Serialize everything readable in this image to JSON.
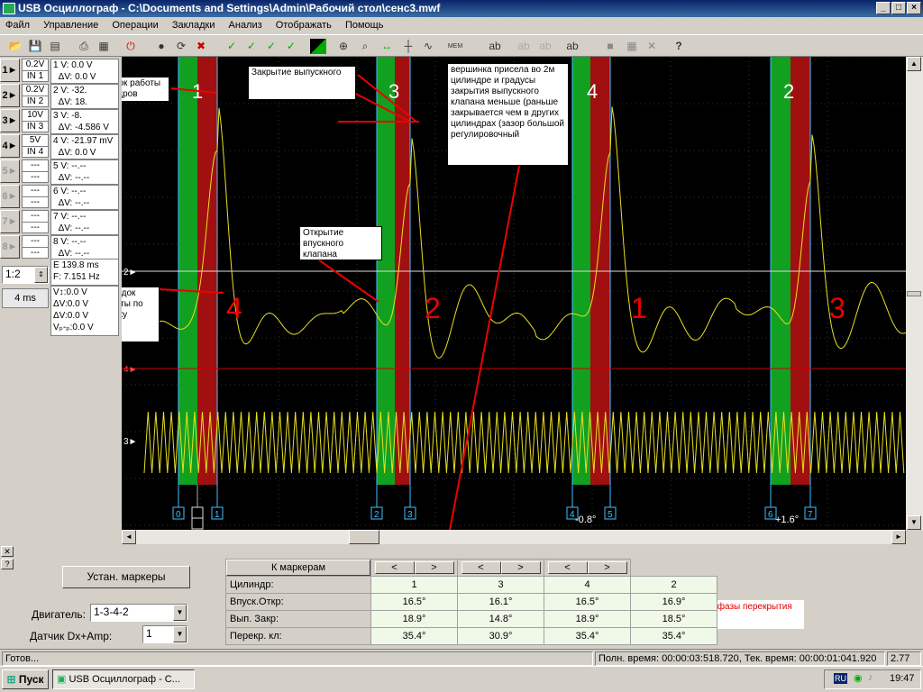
{
  "window": {
    "title": "USB Осциллограф - C:\\Documents and Settings\\Admin\\Рабочий стол\\сенс3.mwf"
  },
  "menu": [
    "Файл",
    "Управление",
    "Операции",
    "Закладки",
    "Анализ",
    "Отображать",
    "Помощь"
  ],
  "channels": [
    {
      "num": "1",
      "scale": "0.2V",
      "input": "IN 1",
      "v": "0.0 V",
      "dv": "0.0 V"
    },
    {
      "num": "2",
      "scale": "0.2V",
      "input": "IN 2",
      "v": "-32.",
      "dv": "18."
    },
    {
      "num": "3",
      "scale": "10V",
      "input": "IN 3",
      "v": "-8.",
      "dv": "-4.586 V"
    },
    {
      "num": "4",
      "scale": "5V",
      "input": "IN 4",
      "v": "-21.97 mV",
      "dv": "0.0 V"
    },
    {
      "num": "5",
      "scale": "---",
      "input": "---",
      "v": "--.--",
      "dv": "--.--"
    },
    {
      "num": "6",
      "scale": "---",
      "input": "---",
      "v": "--.--",
      "dv": "--.--"
    },
    {
      "num": "7",
      "scale": "---",
      "input": "---",
      "v": "--.--",
      "dv": "--.--"
    },
    {
      "num": "8",
      "scale": "---",
      "input": "---",
      "v": "--.--",
      "dv": "--.--"
    }
  ],
  "vlabels": {
    "v": "V:",
    "dv": "ΔV:"
  },
  "timing": {
    "zoom": "1:2",
    "timebase": "4 ms",
    "e": "139.8 ms",
    "f": "7.151 Hz",
    "e_label": "E",
    "f_label": "F:"
  },
  "cursors": {
    "a": "V↕:0.0 V",
    "b": "ΔV:0.0 V",
    "c": "ΔV:0.0 V",
    "d": "Vₚ-ₚ:0.0 V"
  },
  "notes": {
    "firing_order": "Порядок работы цилиндров",
    "exhaust_close": "Закрытие выпускного",
    "top_note": "вершинка присела во 2м цилиндре и градусы закрытия выпускного клапана меньше (раньше закрывается чем в других цилиндрах (зазор большой регулировочный",
    "intake_open": "Открытие впускного клапана",
    "intake_order": "Порядок работы по впуску",
    "overlap_width": "Ширина фазы перекрытия"
  },
  "handwritten": {
    "top": [
      "1",
      "3",
      "4",
      "2"
    ],
    "bottom": [
      "4",
      "2",
      "1",
      "3"
    ]
  },
  "markers": [
    "0",
    "1",
    "2",
    "3",
    "4",
    "5",
    "6",
    "7"
  ],
  "marker_deltas": [
    "-0.8°",
    "+1.6°"
  ],
  "ch_labels": [
    "2",
    "4",
    "3"
  ],
  "bottom": {
    "set_markers": "Устан. маркеры",
    "engine_label": "Двигатель:",
    "engine_value": "1-3-4-2",
    "sensor_label": "Датчик Dx+Amp:",
    "sensor_value": "1",
    "to_markers": "К маркерам",
    "nav_prev": "<",
    "nav_next": ">"
  },
  "table": {
    "rows": [
      {
        "label": "Цилиндр:",
        "values": [
          "1",
          "3",
          "4",
          "2"
        ]
      },
      {
        "label": "Впуск.Откр:",
        "values": [
          "16.5°",
          "16.1°",
          "16.5°",
          "16.9°"
        ]
      },
      {
        "label": "Вып. Закр:",
        "values": [
          "18.9°",
          "14.8°",
          "18.9°",
          "18.5°"
        ]
      },
      {
        "label": "Перекр. кл:",
        "values": [
          "35.4°",
          "30.9°",
          "35.4°",
          "35.4°"
        ]
      }
    ]
  },
  "status": {
    "ready": "Готов...",
    "times": "Полн. время: 00:00:03:518.720, Тек. время: 00:00:01:041.920",
    "value": "2.77"
  },
  "taskbar": {
    "start": "Пуск",
    "task": "USB Осциллограф - С...",
    "lang": "RU",
    "clock": "19:47"
  },
  "colors": {
    "trace": "#e8e020",
    "green": "#12a020",
    "red": "#a01010",
    "cursor": "#40c0ff"
  }
}
